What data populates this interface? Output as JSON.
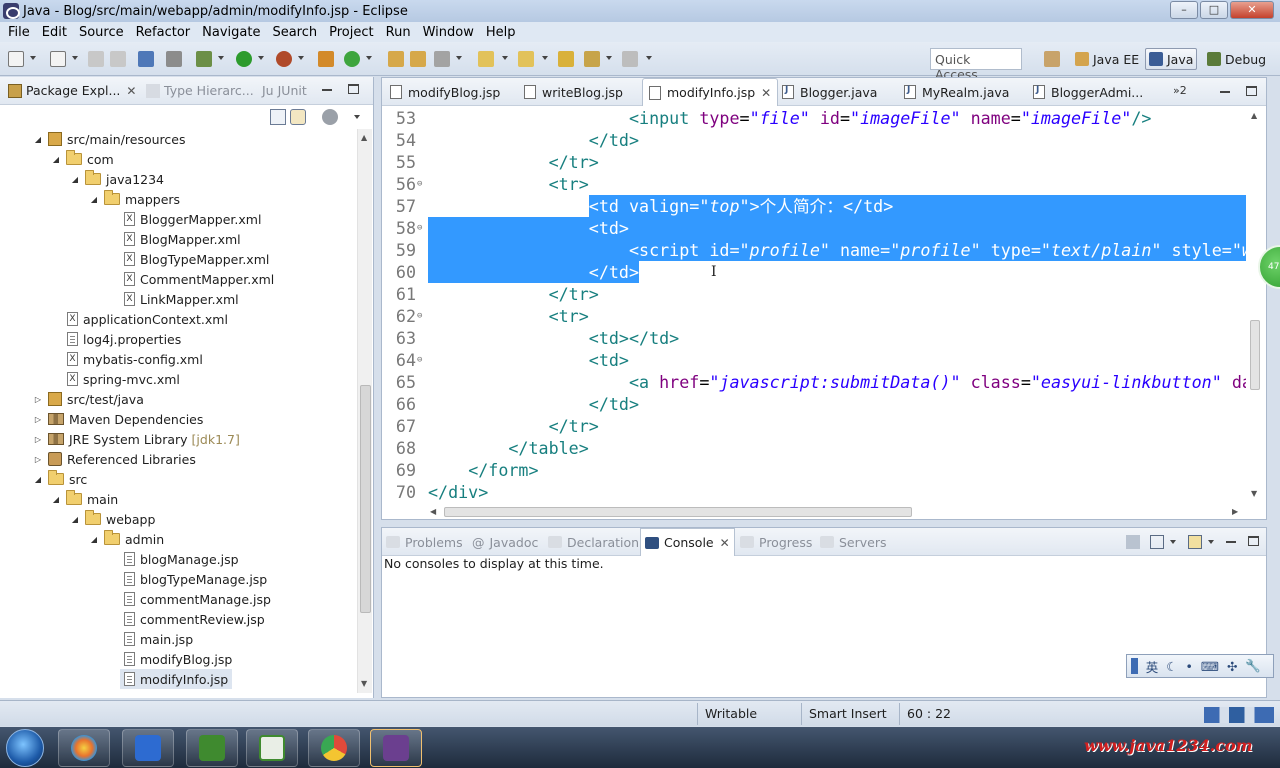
{
  "window": {
    "title": "Java - Blog/src/main/webapp/admin/modifyInfo.jsp - Eclipse",
    "minimize": "–",
    "maximize": "□",
    "close": "✕"
  },
  "menu": [
    "File",
    "Edit",
    "Source",
    "Refactor",
    "Navigate",
    "Search",
    "Project",
    "Run",
    "Window",
    "Help"
  ],
  "toolbar": {
    "quick_access": "Quick Access",
    "perspectives": [
      {
        "label": "Java EE",
        "active": false
      },
      {
        "label": "Java",
        "active": true
      },
      {
        "label": "Debug",
        "active": false
      }
    ]
  },
  "left_panel": {
    "tabs": [
      {
        "label": "Package Expl...",
        "active": true,
        "close": "✕"
      },
      {
        "label": "Type Hierarc...",
        "active": false
      },
      {
        "label": "JUnit",
        "prefix": "Ju",
        "active": false
      }
    ],
    "tree": [
      {
        "label": "src/main/resources",
        "level": 1,
        "expanded": true,
        "icon": "package-folder-icon"
      },
      {
        "label": "com",
        "level": 2,
        "expanded": true,
        "icon": "folder-icon"
      },
      {
        "label": "java1234",
        "level": 3,
        "expanded": true,
        "icon": "folder-icon"
      },
      {
        "label": "mappers",
        "level": 4,
        "expanded": true,
        "icon": "folder-icon"
      },
      {
        "label": "BloggerMapper.xml",
        "level": 5,
        "icon": "xml-file-icon"
      },
      {
        "label": "BlogMapper.xml",
        "level": 5,
        "icon": "xml-file-icon"
      },
      {
        "label": "BlogTypeMapper.xml",
        "level": 5,
        "icon": "xml-file-icon"
      },
      {
        "label": "CommentMapper.xml",
        "level": 5,
        "icon": "xml-file-icon"
      },
      {
        "label": "LinkMapper.xml",
        "level": 5,
        "icon": "xml-file-icon"
      },
      {
        "label": "applicationContext.xml",
        "level": 2,
        "icon": "xml-file-icon"
      },
      {
        "label": "log4j.properties",
        "level": 2,
        "icon": "file-icon"
      },
      {
        "label": "mybatis-config.xml",
        "level": 2,
        "icon": "xml-file-icon"
      },
      {
        "label": "spring-mvc.xml",
        "level": 2,
        "icon": "xml-file-icon"
      },
      {
        "label": "src/test/java",
        "level": 1,
        "expanded": false,
        "icon": "package-folder-icon"
      },
      {
        "label": "Maven Dependencies",
        "level": 1,
        "expanded": false,
        "icon": "library-icon"
      },
      {
        "label": "JRE System Library",
        "decoration": "[jdk1.7]",
        "level": 1,
        "expanded": false,
        "icon": "library-icon"
      },
      {
        "label": "Referenced Libraries",
        "level": 1,
        "expanded": false,
        "icon": "jar-icon"
      },
      {
        "label": "src",
        "level": 1,
        "expanded": true,
        "icon": "folder-icon"
      },
      {
        "label": "main",
        "level": 2,
        "expanded": true,
        "icon": "folder-icon"
      },
      {
        "label": "webapp",
        "level": 3,
        "expanded": true,
        "icon": "folder-icon"
      },
      {
        "label": "admin",
        "level": 4,
        "expanded": true,
        "icon": "folder-icon"
      },
      {
        "label": "blogManage.jsp",
        "level": 5,
        "icon": "file-icon"
      },
      {
        "label": "blogTypeManage.jsp",
        "level": 5,
        "icon": "file-icon"
      },
      {
        "label": "commentManage.jsp",
        "level": 5,
        "icon": "file-icon"
      },
      {
        "label": "commentReview.jsp",
        "level": 5,
        "icon": "file-icon"
      },
      {
        "label": "main.jsp",
        "level": 5,
        "icon": "file-icon"
      },
      {
        "label": "modifyBlog.jsp",
        "level": 5,
        "icon": "file-icon"
      },
      {
        "label": "modifyInfo.jsp",
        "level": 5,
        "icon": "file-icon",
        "selected": true
      }
    ]
  },
  "editor": {
    "tabs": [
      {
        "label": "modifyBlog.jsp",
        "icon": "jsp"
      },
      {
        "label": "writeBlog.jsp",
        "icon": "jsp"
      },
      {
        "label": "modifyInfo.jsp",
        "icon": "jsp",
        "active": true,
        "close": "✕"
      },
      {
        "label": "Blogger.java",
        "icon": "java"
      },
      {
        "label": "MyRealm.java",
        "icon": "java"
      },
      {
        "label": "BloggerAdmi...",
        "icon": "java"
      }
    ],
    "overflow": "»2",
    "lines": [
      {
        "n": "53",
        "indent": 20,
        "tokens": [
          [
            "tag",
            "<input "
          ],
          [
            "attr",
            "type"
          ],
          [
            "text",
            "="
          ],
          [
            "val",
            "\"file\""
          ],
          [
            "text",
            " "
          ],
          [
            "attr",
            "id"
          ],
          [
            "text",
            "="
          ],
          [
            "val",
            "\"imageFile\""
          ],
          [
            "text",
            " "
          ],
          [
            "attr",
            "name"
          ],
          [
            "text",
            "="
          ],
          [
            "val",
            "\"imageFile\""
          ],
          [
            "tag",
            "/>"
          ]
        ]
      },
      {
        "n": "54",
        "indent": 16,
        "tokens": [
          [
            "tag",
            "</td>"
          ]
        ]
      },
      {
        "n": "55",
        "indent": 12,
        "tokens": [
          [
            "tag",
            "</tr>"
          ]
        ]
      },
      {
        "n": "56",
        "indent": 12,
        "fold": true,
        "tokens": [
          [
            "tag",
            "<tr>"
          ]
        ]
      },
      {
        "n": "57",
        "indent": 16,
        "hl": true,
        "tokens": [
          [
            "tag",
            "<td "
          ],
          [
            "attr",
            "valign"
          ],
          [
            "text",
            "="
          ],
          [
            "val",
            "\"top\""
          ],
          [
            "tag",
            ">"
          ],
          [
            "text",
            "个人简介："
          ],
          [
            "tag",
            "</td>"
          ]
        ]
      },
      {
        "n": "58",
        "indent": 16,
        "hl": true,
        "fold": true,
        "tokens": [
          [
            "tag",
            "<td>"
          ]
        ]
      },
      {
        "n": "59",
        "indent": 20,
        "hl": true,
        "tokens": [
          [
            "tag",
            "<script "
          ],
          [
            "attr",
            "id"
          ],
          [
            "text",
            "="
          ],
          [
            "val",
            "\"profile\""
          ],
          [
            "text",
            " "
          ],
          [
            "attr",
            "name"
          ],
          [
            "text",
            "="
          ],
          [
            "val",
            "\"profile\""
          ],
          [
            "text",
            " "
          ],
          [
            "attr",
            "type"
          ],
          [
            "text",
            "="
          ],
          [
            "val",
            "\"text/plain\""
          ],
          [
            "text",
            " "
          ],
          [
            "attr",
            "style"
          ],
          [
            "text",
            "="
          ],
          [
            "val",
            "\"w"
          ]
        ]
      },
      {
        "n": "60",
        "indent": 16,
        "hl": true,
        "tokens": [
          [
            "tag",
            "</td>"
          ]
        ]
      },
      {
        "n": "61",
        "indent": 12,
        "tokens": [
          [
            "tag",
            "</tr>"
          ]
        ]
      },
      {
        "n": "62",
        "indent": 12,
        "fold": true,
        "tokens": [
          [
            "tag",
            "<tr>"
          ]
        ]
      },
      {
        "n": "63",
        "indent": 16,
        "tokens": [
          [
            "tag",
            "<td></td>"
          ]
        ]
      },
      {
        "n": "64",
        "indent": 16,
        "fold": true,
        "tokens": [
          [
            "tag",
            "<td>"
          ]
        ]
      },
      {
        "n": "65",
        "indent": 20,
        "tokens": [
          [
            "tag",
            "<a "
          ],
          [
            "attr",
            "href"
          ],
          [
            "text",
            "="
          ],
          [
            "val",
            "\"javascript:submitData()\""
          ],
          [
            "text",
            " "
          ],
          [
            "attr",
            "class"
          ],
          [
            "text",
            "="
          ],
          [
            "val",
            "\"easyui-linkbutton\""
          ],
          [
            "text",
            " "
          ],
          [
            "attr",
            "da"
          ]
        ]
      },
      {
        "n": "66",
        "indent": 16,
        "tokens": [
          [
            "tag",
            "</td>"
          ]
        ]
      },
      {
        "n": "67",
        "indent": 12,
        "tokens": [
          [
            "tag",
            "</tr>"
          ]
        ]
      },
      {
        "n": "68",
        "indent": 8,
        "tokens": [
          [
            "tag",
            "</table>"
          ]
        ]
      },
      {
        "n": "69",
        "indent": 4,
        "tokens": [
          [
            "tag",
            "</form>"
          ]
        ]
      },
      {
        "n": "70",
        "indent": 0,
        "tokens": [
          [
            "tag",
            "</div>"
          ]
        ]
      }
    ]
  },
  "bottom_panel": {
    "tabs": [
      {
        "label": "Problems",
        "active": false
      },
      {
        "label": "Javadoc",
        "prefix": "@",
        "active": false
      },
      {
        "label": "Declaration",
        "active": false
      },
      {
        "label": "Console",
        "active": true,
        "close": "✕"
      },
      {
        "label": "Progress",
        "active": false
      },
      {
        "label": "Servers",
        "active": false
      }
    ],
    "message": "No consoles to display at this time."
  },
  "ime": {
    "items": [
      "英",
      "☾",
      "•",
      "⌨",
      "✣",
      "🔧"
    ]
  },
  "float_badge": "47",
  "status": {
    "writable": "Writable",
    "insert_mode": "Smart Insert",
    "position": "60 : 22"
  },
  "watermark": "www.java1234.com",
  "colors": {
    "selection": "#3399ff",
    "tag": "#177f7f",
    "attribute": "#7f007f",
    "value": "#2a00ff",
    "watermark": "#d21f1f"
  }
}
